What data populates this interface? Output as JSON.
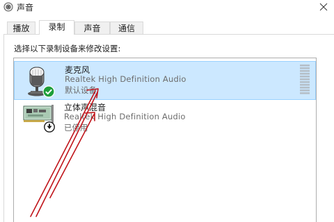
{
  "window": {
    "title": "声音",
    "icon": "speaker-icon",
    "close_icon": "close-icon"
  },
  "tabs": [
    {
      "label": "播放",
      "active": false
    },
    {
      "label": "录制",
      "active": true
    },
    {
      "label": "声音",
      "active": false
    },
    {
      "label": "通信",
      "active": false
    }
  ],
  "instruction": "选择以下录制设备来修改设置:",
  "devices": [
    {
      "name": "麦克风",
      "driver": "Realtek High Definition Audio",
      "status": "默认设备",
      "icon": "microphone-icon",
      "badge_icon": "default-check-icon",
      "selected": true,
      "level": 0
    },
    {
      "name": "立体声混音",
      "driver": "Realtek High Definition Audio",
      "status": "已停用",
      "icon": "sound-card-icon",
      "badge_icon": "disabled-arrow-icon",
      "selected": false
    }
  ],
  "colors": {
    "selection_fill": "#cce8ff",
    "selection_border": "#99d1ff",
    "check_badge": "#1e9e3a",
    "annotation_arrow": "#c0141a",
    "meter_segment": "#b5bfc8"
  }
}
